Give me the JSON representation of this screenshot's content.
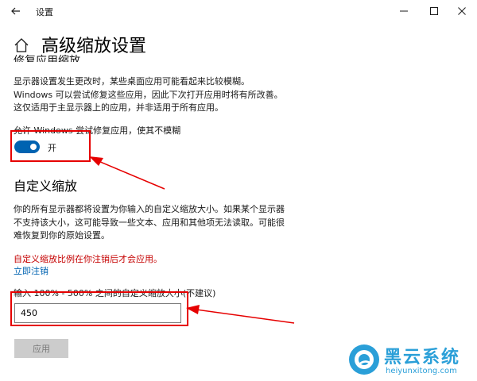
{
  "titlebar": {
    "title": "设置"
  },
  "page": {
    "title": "高级缩放设置"
  },
  "fix_apps": {
    "heading_partial": "修复应用缩放",
    "description": "显示器设置发生更改时，某些桌面应用可能看起来比较模糊。Windows 可以尝试修复这些应用，因此下次打开应用时将有所改善。这仅适用于主显示器上的应用，并非适用于所有应用。",
    "toggle_caption": "允许 Windows 尝试修复应用，使其不模糊",
    "toggle_state": "开"
  },
  "custom_scaling": {
    "heading": "自定义缩放",
    "description": "你的所有显示器都将设置为你输入的自定义缩放大小。如果某个显示器不支持该大小，这可能导致一些文本、应用和其他项无法读取。可能很难恢复到你的原始设置。",
    "warning": "自定义缩放比例在你注销后才会应用。",
    "signout_link": "立即注销",
    "input_label": "输入 100% - 500% 之间的自定义缩放大小(不建议)",
    "input_value": "450",
    "apply_label": "应用"
  },
  "watermark": {
    "name": "黑云系统",
    "url": "heiyunxitong.com"
  },
  "colors": {
    "accent": "#0063b1",
    "warning": "#c50000",
    "annotation": "#e60000",
    "watermark": "#2a9fd8"
  },
  "icons": [
    "back-arrow-icon",
    "minimize-icon",
    "maximize-icon",
    "close-icon",
    "home-icon"
  ]
}
